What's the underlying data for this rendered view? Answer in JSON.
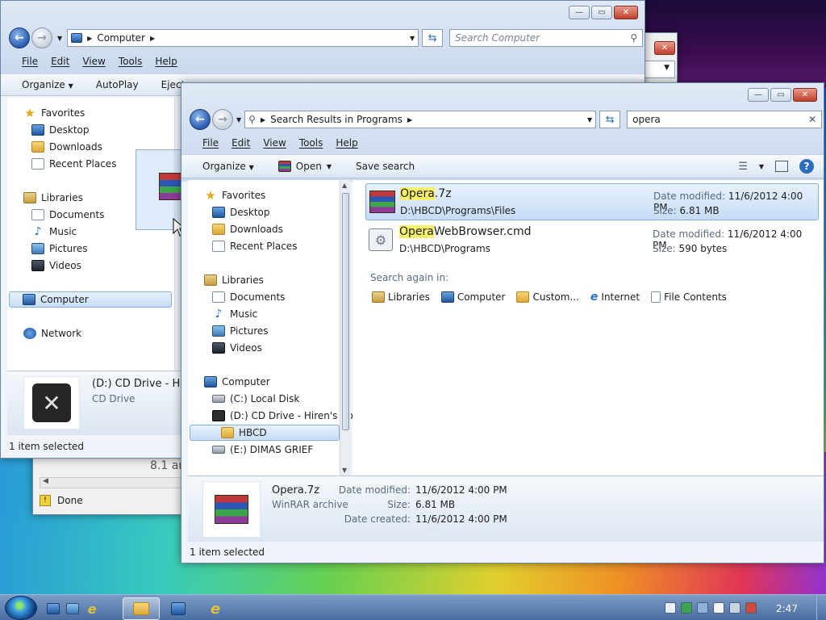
{
  "background_window": {
    "address": [
      "Computer"
    ],
    "search_placeholder": "Search Computer",
    "menu": [
      "File",
      "Edit",
      "View",
      "Tools",
      "Help"
    ],
    "commands": [
      "Organize",
      "AutoPlay",
      "Eject"
    ],
    "nav": {
      "favorites_label": "Favorites",
      "favorites": [
        "Desktop",
        "Downloads",
        "Recent Places"
      ],
      "libraries_label": "Libraries",
      "libraries": [
        "Documents",
        "Music",
        "Pictures",
        "Videos"
      ],
      "computer_label": "Computer",
      "network_label": "Network"
    },
    "details": {
      "name": "(D:) CD Drive - Hire",
      "type": "CD Drive"
    },
    "status": "1 item selected"
  },
  "third_window": {
    "partial_text": "8.1 an",
    "status": "Done"
  },
  "front_window": {
    "address": [
      "Search Results in Programs"
    ],
    "search_value": "opera",
    "menu": [
      "File",
      "Edit",
      "View",
      "Tools",
      "Help"
    ],
    "commands": {
      "organize": "Organize",
      "open": "Open",
      "save_search": "Save search"
    },
    "nav": {
      "favorites_label": "Favorites",
      "favorites": [
        "Desktop",
        "Downloads",
        "Recent Places"
      ],
      "libraries_label": "Libraries",
      "libraries": [
        "Documents",
        "Music",
        "Pictures",
        "Videos"
      ],
      "computer_label": "Computer",
      "drives": [
        "(C:) Local Disk",
        "(D:) CD Drive - Hiren's Boo"
      ],
      "hbcd": "HBCD",
      "drive_e": "(E:) DIMAS GRIEF"
    },
    "results": [
      {
        "name_highlight": "Opera",
        "name_rest": ".7z",
        "path": "D:\\HBCD\\Programs\\Files",
        "date_label": "Date modified:",
        "date": "11/6/2012 4:00 PM",
        "size_label": "Size:",
        "size": "6.81 MB"
      },
      {
        "name_highlight": "Opera",
        "name_rest": "WebBrowser.cmd",
        "path": "D:\\HBCD\\Programs",
        "date_label": "Date modified:",
        "date": "11/6/2012 4:00 PM",
        "size_label": "Size:",
        "size": "590 bytes"
      }
    ],
    "search_again": {
      "label": "Search again in:",
      "options": [
        "Libraries",
        "Computer",
        "Custom...",
        "Internet",
        "File Contents"
      ]
    },
    "details": {
      "name": "Opera.7z",
      "type": "WinRAR archive",
      "date_modified_label": "Date modified:",
      "date_modified": "11/6/2012 4:00 PM",
      "size_label": "Size:",
      "size": "6.81 MB",
      "date_created_label": "Date created:",
      "date_created": "11/6/2012 4:00 PM"
    },
    "status": "1 item selected"
  },
  "taskbar": {
    "clock": "2:47"
  }
}
